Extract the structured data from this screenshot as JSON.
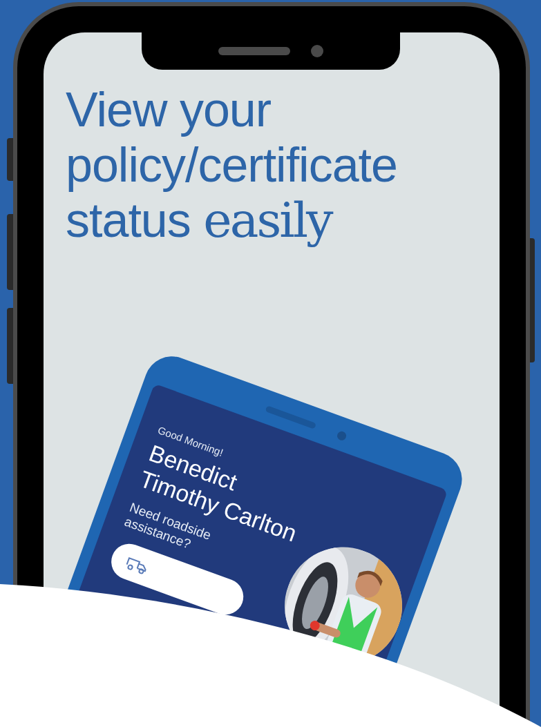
{
  "headline": {
    "text": "View your policy/certificate status",
    "accent": "easily"
  },
  "app_preview": {
    "greeting": "Good Morning!",
    "user_name": "Benedict Timothy Carlton",
    "prompt": "Need roadside assistance?"
  }
}
